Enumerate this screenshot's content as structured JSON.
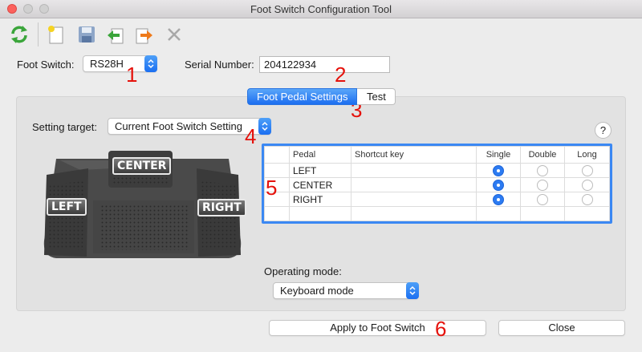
{
  "window": {
    "title": "Foot Switch Configuration Tool"
  },
  "toolbar": {
    "icons": [
      "refresh-icon",
      "new-file-icon",
      "save-icon",
      "import-icon",
      "export-icon",
      "delete-icon"
    ]
  },
  "foot_switch": {
    "label": "Foot Switch:",
    "value": "RS28H"
  },
  "serial": {
    "label": "Serial Number:",
    "value": "204122934"
  },
  "tabs": [
    {
      "label": "Foot Pedal Settings",
      "active": true
    },
    {
      "label": "Test",
      "active": false
    }
  ],
  "setting_target": {
    "label": "Setting target:",
    "value": "Current Foot Switch Setting"
  },
  "help": {
    "label": "?"
  },
  "pedal_image": {
    "center": "CENTER",
    "left": "LEFT",
    "right": "RIGHT"
  },
  "table": {
    "headers": [
      "Pedal",
      "Shortcut key",
      "Single",
      "Double",
      "Long"
    ],
    "rows": [
      {
        "pedal": "LEFT",
        "shortcut": "",
        "selected": "Single"
      },
      {
        "pedal": "CENTER",
        "shortcut": "",
        "selected": "Single"
      },
      {
        "pedal": "RIGHT",
        "shortcut": "",
        "selected": "Single"
      }
    ]
  },
  "operating_mode": {
    "label": "Operating mode:",
    "value": "Keyboard mode"
  },
  "buttons": {
    "apply": "Apply to Foot Switch",
    "close": "Close"
  },
  "annotations": [
    "1",
    "2",
    "3",
    "4",
    "5",
    "6"
  ],
  "colors": {
    "accent": "#1c6ef0",
    "annotation": "#e5120c",
    "panel": "#e2e2e2"
  }
}
